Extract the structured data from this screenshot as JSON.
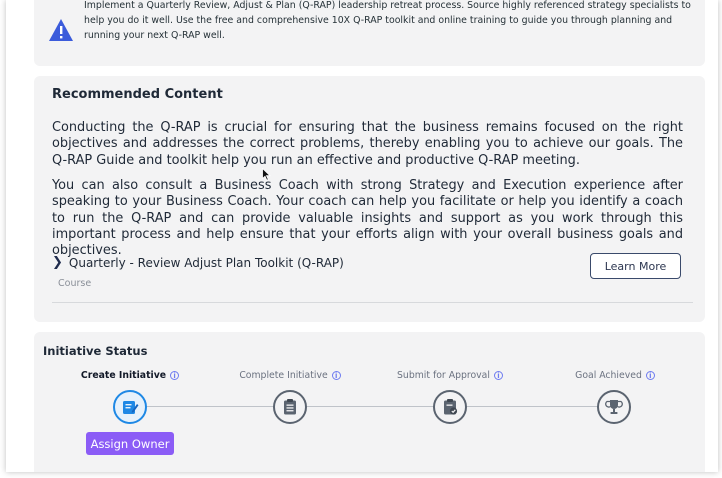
{
  "info_card": {
    "text": "Implement a Quarterly Review, Adjust & Plan (Q-RAP) leadership retreat process. Source highly referenced strategy specialists to help you do it well. Use the free and comprehensive 10X Q-RAP toolkit and online training to guide you through planning and running your next Q-RAP well.",
    "icon": "warning-triangle-icon"
  },
  "recommended": {
    "title": "Recommended Content",
    "paragraph1": "Conducting the Q-RAP is crucial for ensuring that the business remains focused on the right objectives and addresses the correct problems, thereby enabling you to achieve our goals. The Q-RAP Guide and toolkit help you run an effective and productive Q-RAP meeting.",
    "paragraph2": "You can also consult a Business Coach with strong Strategy and Execution experience after speaking to your Business Coach. Your coach can help you facilitate or help you identify a coach to run the Q-RAP and can provide valuable insights and support as you work through this important process and help ensure that your efforts align with your overall business goals and objectives.",
    "item": {
      "title": "Quarterly - Review Adjust Plan Toolkit (Q-RAP)",
      "type": "Course",
      "button": "Learn More"
    }
  },
  "initiative": {
    "title": "Initiative Status",
    "steps": [
      {
        "label": "Create Initiative",
        "icon": "edit-note-icon",
        "active": true
      },
      {
        "label": "Complete Initiative",
        "icon": "clipboard-list-icon",
        "active": false
      },
      {
        "label": "Submit for Approval",
        "icon": "clipboard-check-icon",
        "active": false
      },
      {
        "label": "Goal Achieved",
        "icon": "trophy-icon",
        "active": false
      }
    ],
    "assign_button": "Assign Owner",
    "info_symbol": "i"
  },
  "colors": {
    "accent_blue": "#1e88e5",
    "assign_purple": "#8b5cf6",
    "card_bg": "#f3f3f4"
  }
}
